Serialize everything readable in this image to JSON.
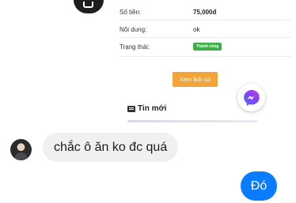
{
  "shared_screenshot": {
    "rows": [
      {
        "key": "Số tiền:",
        "value": "75,000đ",
        "bold": true
      },
      {
        "key": "Nội dung:",
        "value": "ok",
        "bold": false
      },
      {
        "key": "Trạng thái:",
        "badge": "Thành công"
      }
    ],
    "history_button": "Xem lịch sử",
    "news_heading": "Tin mới",
    "badge_color": "#3fae49",
    "button_color": "#f0a43a"
  },
  "messenger": {
    "icon": "messenger-icon",
    "color": "#8b3cf6"
  },
  "chat": {
    "incoming": {
      "text": "chắc ô ăn ko đc quá"
    },
    "outgoing": {
      "text": "Đó",
      "color": "#0a7cff"
    }
  }
}
